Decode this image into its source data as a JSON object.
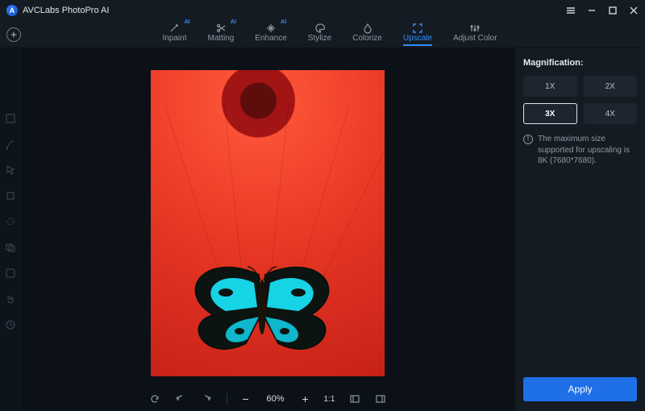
{
  "app": {
    "title": "AVCLabs PhotoPro AI"
  },
  "tabs": [
    {
      "label": "Inpaint",
      "ai": true,
      "icon": "wand"
    },
    {
      "label": "Matting",
      "ai": true,
      "icon": "scissors"
    },
    {
      "label": "Enhance",
      "ai": true,
      "icon": "sparkle"
    },
    {
      "label": "Stylize",
      "ai": false,
      "icon": "palette"
    },
    {
      "label": "Colorize",
      "ai": false,
      "icon": "droplet"
    },
    {
      "label": "Upscale",
      "ai": false,
      "icon": "expand",
      "active": true
    },
    {
      "label": "Adjust Color",
      "ai": false,
      "icon": "sliders"
    }
  ],
  "ai_badge": "AI",
  "panel": {
    "title": "Magnification:",
    "options": [
      "1X",
      "2X",
      "3X",
      "4X"
    ],
    "selected": "3X",
    "info": "The maximum size supported for upscaling is 8K (7680*7680).",
    "apply": "Apply"
  },
  "bottom": {
    "zoom": "60%",
    "ratio": "1:1"
  }
}
